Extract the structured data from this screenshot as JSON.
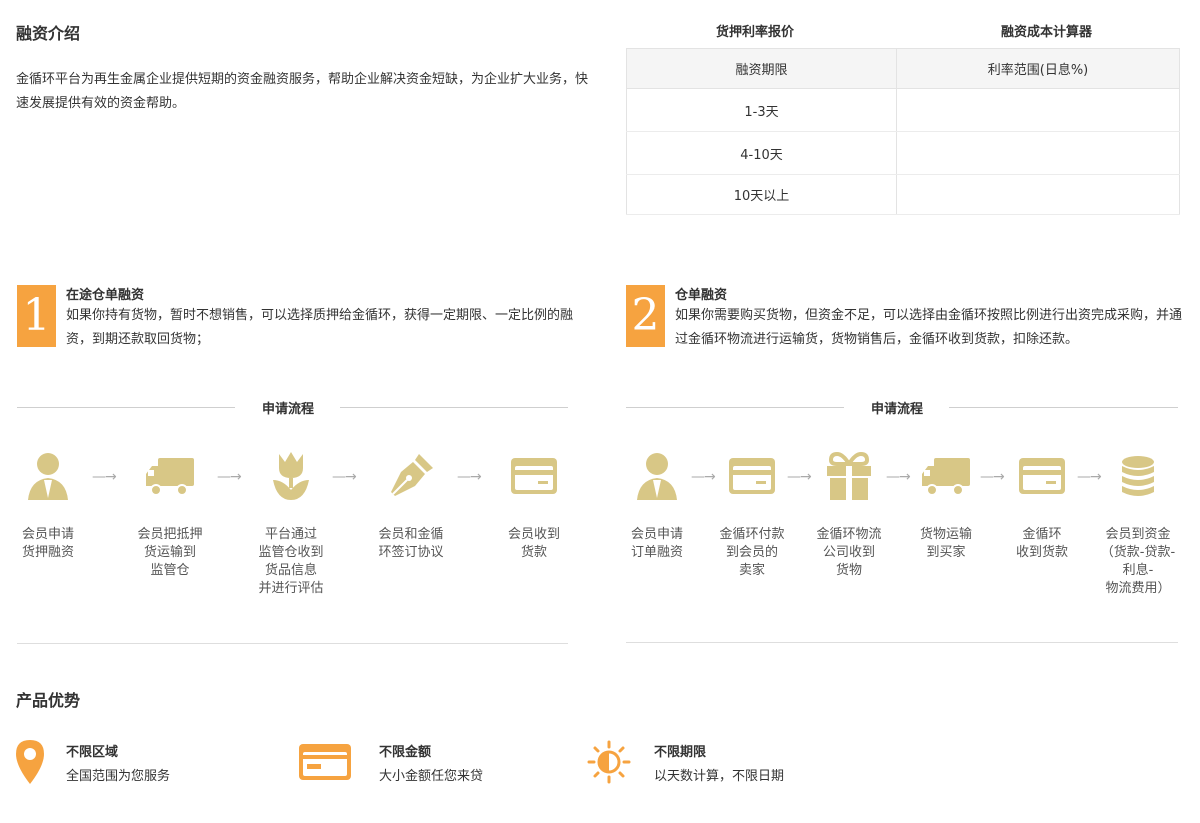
{
  "intro": {
    "title": "融资介绍",
    "text": "金循环平台为再生金属企业提供短期的资金融资服务，帮助企业解决资金短缺，为企业扩大业务，快速发展提供有效的资金帮助。"
  },
  "rate_tabs": {
    "tab1": "货押利率报价",
    "tab2": "融资成本计算器"
  },
  "rate_table": {
    "headers": [
      "融资期限",
      "利率范围(日息%)"
    ],
    "rows": [
      {
        "term": "1-3天",
        "rate": ""
      },
      {
        "term": "4-10天",
        "rate": ""
      },
      {
        "term": "10天以上",
        "rate": ""
      }
    ]
  },
  "financing": [
    {
      "number": "1",
      "title": "在途仓单融资",
      "desc": "如果你持有货物，暂时不想销售，可以选择质押给金循环，获得一定期限、一定比例的融资，到期还款取回货物；"
    },
    {
      "number": "2",
      "title": "仓单融资",
      "desc": "如果你需要购买货物，但资金不足，可以选择由金循环按照比例进行出资完成采购，并通过金循环物流进行运输货，货物销售后，金循环收到货款，扣除还款。"
    }
  ],
  "process_title": "申请流程",
  "process1": [
    {
      "icon": "person-icon",
      "label": [
        "会员申请",
        "货押融资"
      ]
    },
    {
      "icon": "truck-icon",
      "label": [
        "会员把抵押",
        "货运输到",
        "监管仓"
      ]
    },
    {
      "icon": "tulip-icon",
      "label": [
        "平台通过",
        "监管仓收到",
        "货品信息",
        "并进行评估"
      ]
    },
    {
      "icon": "pen-icon",
      "label": [
        "会员和金循",
        "环签订协议"
      ]
    },
    {
      "icon": "card-icon",
      "label": [
        "会员收到",
        "货款"
      ]
    }
  ],
  "process2": [
    {
      "icon": "person-icon",
      "label": [
        "会员申请",
        "订单融资"
      ]
    },
    {
      "icon": "card-icon",
      "label": [
        "金循环付款",
        "到会员的",
        "卖家"
      ]
    },
    {
      "icon": "gift-icon",
      "label": [
        "金循环物流",
        "公司收到",
        "货物"
      ]
    },
    {
      "icon": "truck-icon",
      "label": [
        "货物运输",
        "到买家"
      ]
    },
    {
      "icon": "card-icon",
      "label": [
        "金循环",
        "收到货款"
      ]
    },
    {
      "icon": "coins-icon",
      "label": [
        "会员到资金",
        "（货款-贷款-",
        "利息-",
        "物流费用）"
      ]
    }
  ],
  "arrow_glyph": "—→",
  "advantages": {
    "title": "产品优势",
    "items": [
      {
        "icon": "location-pin-icon",
        "title": "不限区域",
        "desc": "全国范围为您服务"
      },
      {
        "icon": "credit-card-icon",
        "title": "不限金额",
        "desc": "大小金额任您来贷"
      },
      {
        "icon": "sun-icon",
        "title": "不限期限",
        "desc": "以天数计算，不限日期"
      }
    ]
  },
  "colors": {
    "accent_orange": "#f6a340",
    "icon_gold": "#d8c786",
    "text": "#333333"
  }
}
